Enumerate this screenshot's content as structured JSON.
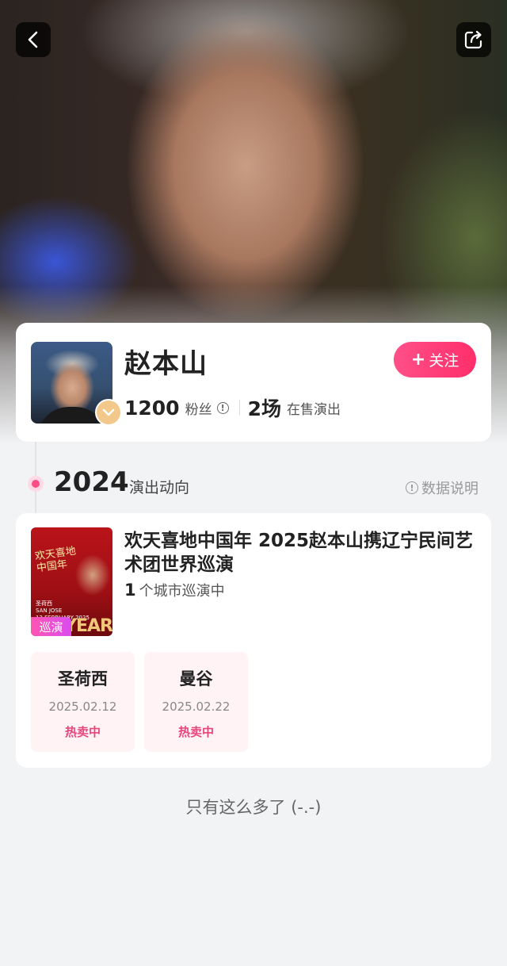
{
  "artist": {
    "name": "赵本山",
    "follow_label": "关注",
    "fans_count": "1200",
    "fans_label": "粉丝",
    "shows_count": "2场",
    "shows_label": "在售演出"
  },
  "timeline": {
    "year": "2024",
    "section_title": "演出动向",
    "data_note_label": "数据说明"
  },
  "show": {
    "title": "欢天喜地中国年 2025赵本山携辽宁民间艺术团世界巡演",
    "city_count": "1",
    "city_count_label": "个城市巡演中",
    "poster": {
      "title_line1": "欢天喜地",
      "title_line2": "中国年",
      "sub_line1": "圣荷西",
      "sub_line2": "SAN JOSE",
      "sub_line3": "12 FEBRUARY 2025",
      "year_text": "YEAR",
      "tag": "巡演"
    },
    "cities": [
      {
        "name": "圣荷西",
        "date": "2025.02.12",
        "status": "热卖中"
      },
      {
        "name": "曼谷",
        "date": "2025.02.22",
        "status": "热卖中"
      }
    ]
  },
  "footer": {
    "end_text": "只有这么多了 (-.-)"
  },
  "icons": {
    "back": "chevron-left-icon",
    "share": "share-icon",
    "verified": "verified-badge-icon",
    "info": "info-icon"
  },
  "colors": {
    "accent": "#ff3f78",
    "badge": "#f2c98a",
    "status": "#e8457d"
  }
}
